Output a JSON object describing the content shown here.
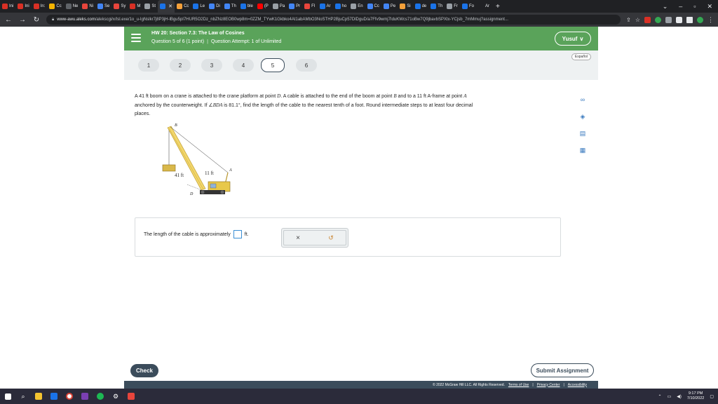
{
  "browser": {
    "tabs": [
      {
        "label": "Ini",
        "color": "#d93025"
      },
      {
        "label": "Ini",
        "color": "#d93025"
      },
      {
        "label": "In:",
        "color": "#d93025"
      },
      {
        "label": "Cc",
        "color": "#f4b400"
      },
      {
        "label": "Ne",
        "color": "#5f6368"
      },
      {
        "label": "Ni",
        "color": "#e8453c"
      },
      {
        "label": "Se",
        "color": "#4285f4"
      },
      {
        "label": "Sy",
        "color": "#e8453c"
      },
      {
        "label": "M",
        "color": "#d93025"
      },
      {
        "label": "St",
        "color": "#9aa0a6"
      },
      {
        "label": "",
        "color": "#1a73e8",
        "active": true
      },
      {
        "label": "Cc",
        "color": "#f4a03a"
      },
      {
        "label": "Le",
        "color": "#1a73e8"
      },
      {
        "label": "Di",
        "color": "#4285f4"
      },
      {
        "label": "Th",
        "color": "#4285f4"
      },
      {
        "label": "ble",
        "color": "#1a73e8"
      },
      {
        "label": "(P",
        "color": "#ff0000"
      },
      {
        "label": "Pa",
        "color": "#9aa0a6"
      },
      {
        "label": "Pr",
        "color": "#4285f4"
      },
      {
        "label": "FI",
        "color": "#e8453c"
      },
      {
        "label": "Ar",
        "color": "#1a73e8"
      },
      {
        "label": "ho",
        "color": "#1a73e8"
      },
      {
        "label": "En",
        "color": "#9aa0a6"
      },
      {
        "label": "Cc",
        "color": "#4285f4"
      },
      {
        "label": "Pe",
        "color": "#4285f4"
      },
      {
        "label": "Si",
        "color": "#f4a03a"
      },
      {
        "label": "de",
        "color": "#1a73e8"
      },
      {
        "label": "Th",
        "color": "#1a73e8"
      },
      {
        "label": "Fr",
        "color": "#9aa0a6"
      },
      {
        "label": "Fo",
        "color": "#1a73e8"
      },
      {
        "label": "Ar",
        "color": "#202124"
      }
    ],
    "new_tab": "+",
    "url_host": "www-awu.aleks.com",
    "url_path": "/alekscgi/x/Isl.exe/1o_u-IgNslkr7j8P3jH-lBgu5pI7HUR5O2Dz_nbZNz8EOB0wp8m=0ZZM_TYwK1Gkbko4At1abAMbO3NoSTHP2BjuCp57DlDguD/a7Ffv9wmj7IduKWcs71oBw7Q9jbavbSPXtx-YCjsb_7mMmuj?assignment..."
  },
  "header": {
    "title": "HW 20: Section 7.3: The Law of Cosines",
    "question_info": "Question 5 of 6 (1 point)",
    "separator": "|",
    "attempt": "Question Attempt: 1 of Unlimited",
    "user": "Yusuf",
    "user_chevron": "∨"
  },
  "question_nav": {
    "numbers": [
      "1",
      "2",
      "3",
      "4",
      "5",
      "6"
    ],
    "current": "5",
    "espanol": "Español"
  },
  "problem": {
    "line1_a": "A 41 ft boom on a crane is attached to the crane platform at point ",
    "point_d": "D",
    "line1_b": ". A cable is attached to the end of the boom at point ",
    "point_b": "B",
    "line1_c": " and to a 11 ft A-frame at point ",
    "point_a": "A",
    "line2_a": "anchored by the counterweight. If ∠",
    "angle": "BDA",
    "line2_b": " is 81.1°, find the length of the cable to the nearest tenth of a foot. Round intermediate steps to at least four decimal",
    "line3": "places."
  },
  "figure": {
    "label_b": "B",
    "label_a": "A",
    "label_d": "D",
    "boom_length": "41 ft",
    "aframe_length": "11 ft"
  },
  "answer": {
    "prefix": "The length of the cable is approximately",
    "unit": "ft.",
    "clear_icon": "×",
    "undo_icon": "↺"
  },
  "side_tools": {
    "icons": [
      "link-icon",
      "settings-icon",
      "textbook-icon",
      "calculator-icon"
    ]
  },
  "buttons": {
    "check": "Check",
    "submit": "Submit Assignment"
  },
  "footer": {
    "copyright": "© 2022 McGraw Hill LLC. All Rights Reserved.",
    "terms": "Terms of Use",
    "sep1": "|",
    "privacy": "Privacy Center",
    "sep2": "|",
    "accessibility": "Accessibility"
  },
  "taskbar": {
    "time": "9:17 PM",
    "date": "7/10/2022"
  },
  "colors": {
    "header_green": "#5aa35a",
    "nav_dark": "#3b4c5b",
    "crane_yellow": "#e8c84a"
  }
}
